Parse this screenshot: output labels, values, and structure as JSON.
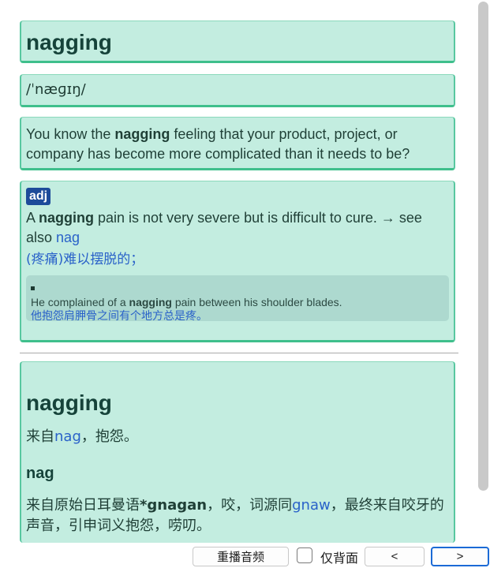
{
  "word": "nagging",
  "phonetic": "/ˈnæɡɪŋ/",
  "example": {
    "before": "You know the ",
    "bold": "nagging",
    "after": " feeling that your product, project, or company has become more complicated than it needs to be?"
  },
  "definition": {
    "pos": "adj",
    "text_before": "A ",
    "text_bold": "nagging",
    "text_after": " pain is not very severe but is difficult to cure. → see also ",
    "link": "nag",
    "chinese": "(疼痛)难以摆脱的；",
    "sentence_en_before": "He complained of a ",
    "sentence_en_bold": "nagging",
    "sentence_en_after": " pain between his shoulder blades.",
    "sentence_cn": "他抱怨肩胛骨之间有个地方总是疼。"
  },
  "etymology": {
    "title": "nagging",
    "line1_before": "来自",
    "line1_link": "nag",
    "line1_after": "，抱怨。",
    "subtitle": "nag",
    "line2_before": "来自原始日耳曼语",
    "line2_bold": "*gnagan",
    "line2_mid": "，咬，词源同",
    "line2_link": "gnaw",
    "line2_after": "，最终来自咬牙的声音，引申词义抱怨，唠叨。"
  },
  "controls": {
    "replay": "重播音频",
    "back_only": "仅背面",
    "prev": "<",
    "next": ">"
  },
  "colors": {
    "card_bg": "#c3ede0",
    "card_border": "#3fbf8c",
    "badge_bg": "#1d4b9a",
    "link": "#2a62c9"
  }
}
